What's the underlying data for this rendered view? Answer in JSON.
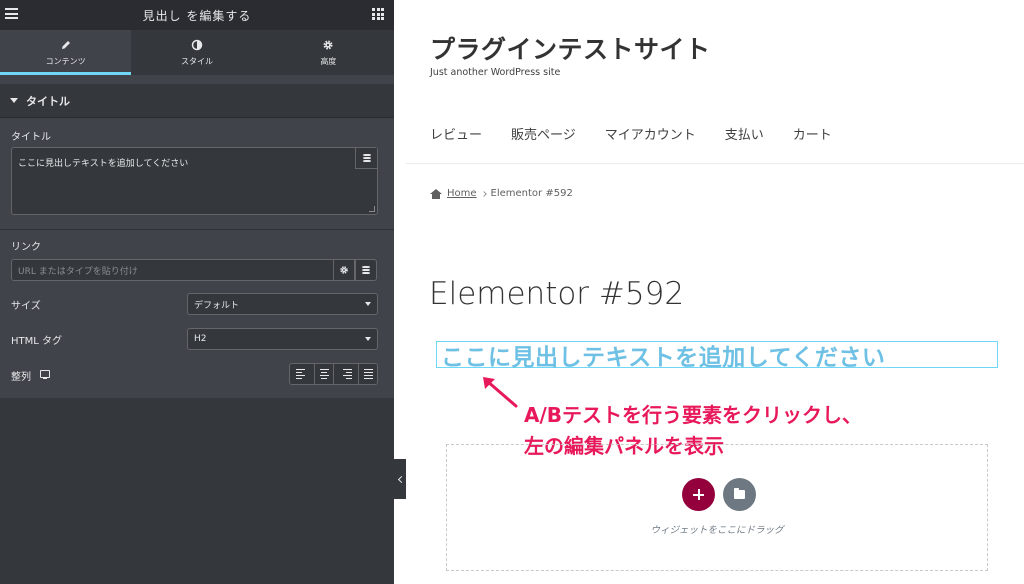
{
  "panel": {
    "header_title": "見出し を編集する",
    "tabs": [
      {
        "label": "コンテンツ",
        "icon": "pencil-icon",
        "active": true
      },
      {
        "label": "スタイル",
        "icon": "half-circle-icon",
        "active": false
      },
      {
        "label": "高度",
        "icon": "gear-icon",
        "active": false
      }
    ],
    "section_title": "タイトル",
    "title_label": "タイトル",
    "title_value": "ここに見出しテキストを追加してください",
    "link_label": "リンク",
    "link_placeholder": "URL またはタイプを貼り付け",
    "size_label": "サイズ",
    "size_value": "デフォルト",
    "html_tag_label": "HTML タグ",
    "html_tag_value": "H2",
    "alignment_label": "整列"
  },
  "site": {
    "title": "プラグインテストサイト",
    "tagline": "Just another WordPress site",
    "nav": [
      "レビュー",
      "販売ページ",
      "マイアカウント",
      "支払い",
      "カート"
    ],
    "breadcrumb_home": "Home",
    "breadcrumb_current": "Elementor #592",
    "page_title": "Elementor #592",
    "heading_text": "ここに見出しテキストを追加してください",
    "drop_hint": "ウィジェットをここにドラッグ"
  },
  "annotation": {
    "line1": "A/Bテストを行う要素をクリックし、",
    "line2": "左の編集パネルを表示"
  },
  "colors": {
    "accent_tab": "#71d7f7",
    "heading": "#6ec1e4",
    "annotation": "#e8195a",
    "add_button": "#93003c",
    "template_button": "#6d7882"
  }
}
